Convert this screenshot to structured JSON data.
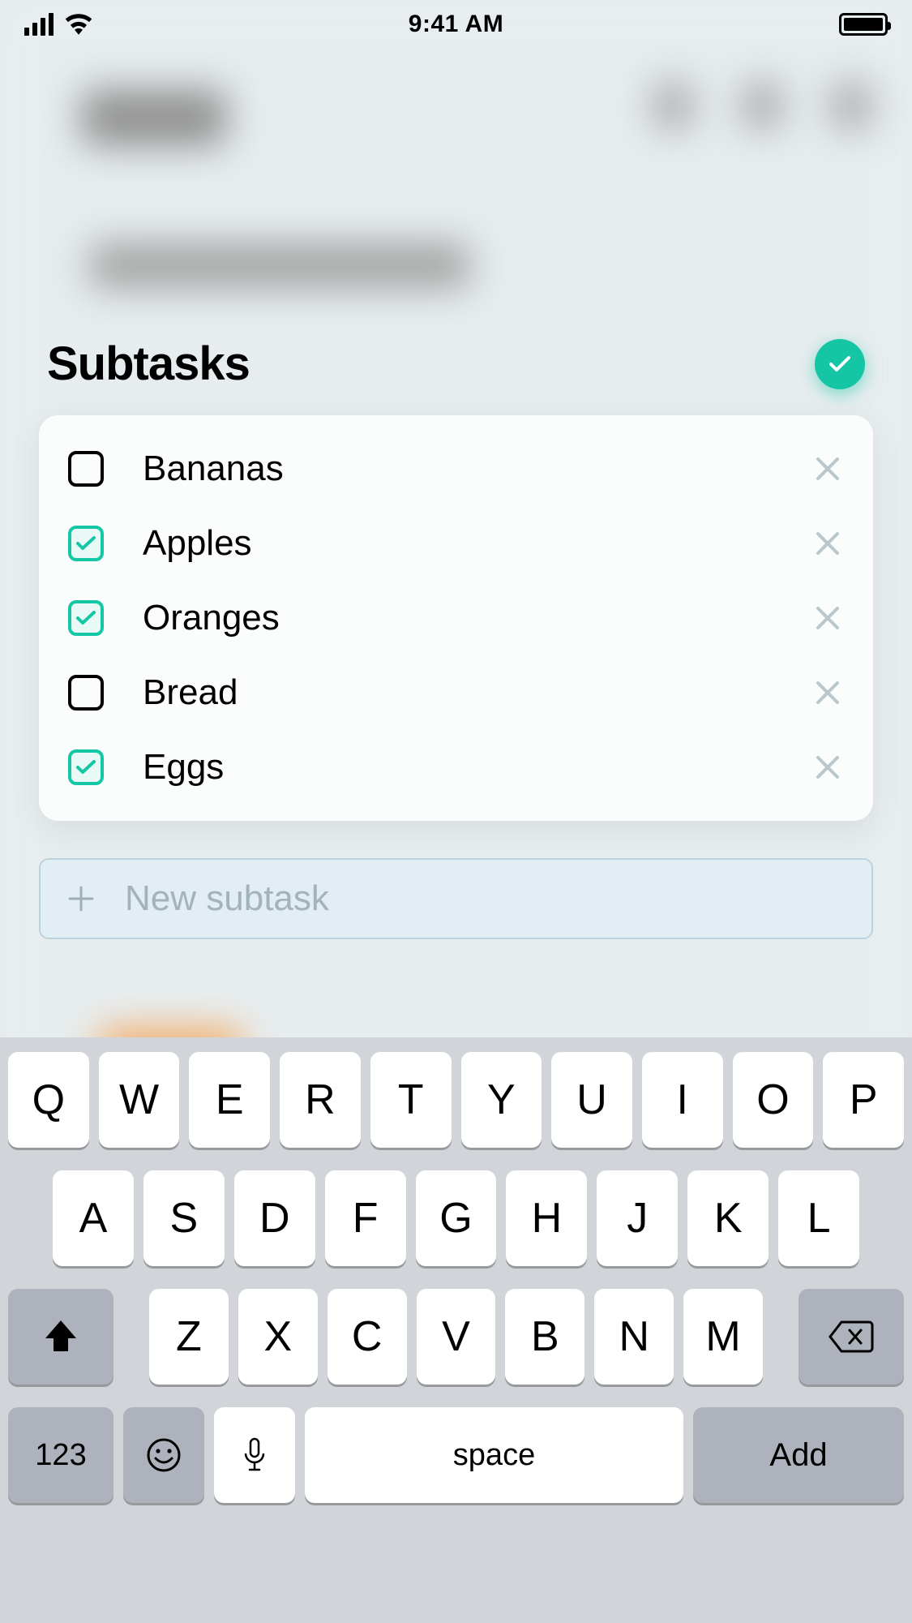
{
  "status_bar": {
    "time": "9:41 AM"
  },
  "section": {
    "title": "Subtasks"
  },
  "subtasks": [
    {
      "label": "Bananas",
      "checked": false
    },
    {
      "label": "Apples",
      "checked": true
    },
    {
      "label": "Oranges",
      "checked": true
    },
    {
      "label": "Bread",
      "checked": false
    },
    {
      "label": "Eggs",
      "checked": true
    }
  ],
  "new_subtask": {
    "placeholder": "New subtask"
  },
  "keyboard": {
    "row1": [
      "Q",
      "W",
      "E",
      "R",
      "T",
      "Y",
      "U",
      "I",
      "O",
      "P"
    ],
    "row2": [
      "A",
      "S",
      "D",
      "F",
      "G",
      "H",
      "J",
      "K",
      "L"
    ],
    "row3": [
      "Z",
      "X",
      "C",
      "V",
      "B",
      "N",
      "M"
    ],
    "numeric_label": "123",
    "space_label": "space",
    "return_label": "Add"
  },
  "colors": {
    "accent": "#14c6a4"
  }
}
